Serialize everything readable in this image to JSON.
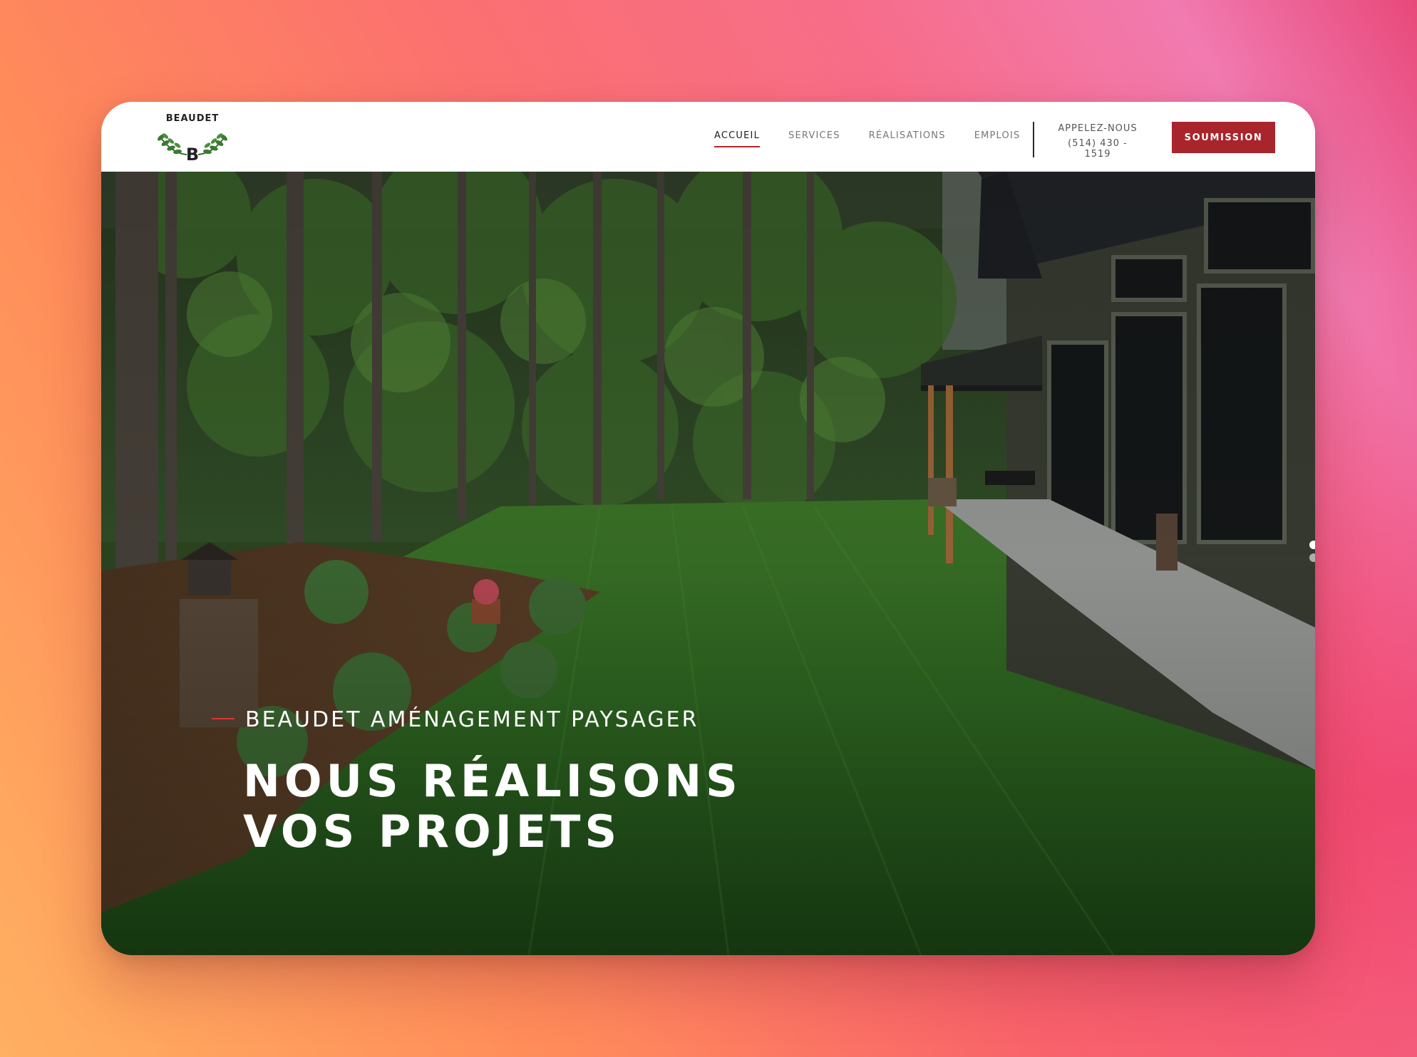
{
  "brand": {
    "name": "BEAUDET",
    "initial": "B",
    "accent_color": "#a8252b"
  },
  "nav": {
    "items": [
      {
        "label": "ACCUEIL",
        "active": true
      },
      {
        "label": "SERVICES",
        "active": false
      },
      {
        "label": "RÉALISATIONS",
        "active": false
      },
      {
        "label": "EMPLOIS",
        "active": false
      }
    ]
  },
  "contact": {
    "label": "APPELEZ-NOUS",
    "phone": "(514) 430 - 1519"
  },
  "cta": {
    "label": "SOUMISSION"
  },
  "hero": {
    "kicker": "BEAUDET AMÉNAGEMENT PAYSAGER",
    "headline_line1": "NOUS RÉALISONS",
    "headline_line2": "VOS PROJETS",
    "slide_indicator": {
      "count": 2,
      "active_index": 0
    }
  }
}
